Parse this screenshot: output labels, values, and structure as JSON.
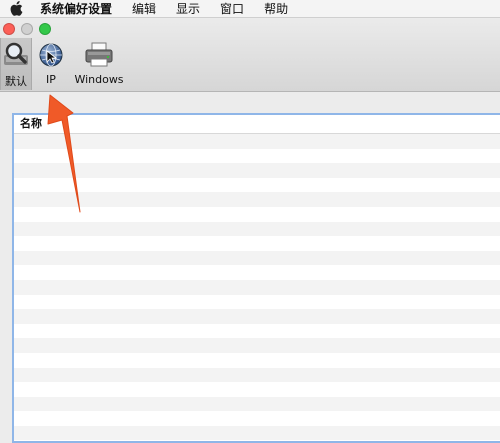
{
  "menubar": {
    "apple_icon": "apple-logo-icon",
    "items": [
      "系统偏好设置",
      "编辑",
      "显示",
      "窗口",
      "帮助"
    ]
  },
  "window": {
    "traffic_lights": {
      "close": "#fc5f57",
      "minimize": "#d0d0d0",
      "zoom": "#34c84a"
    },
    "toolbar": [
      {
        "label": "默认",
        "icon": "magnifier-icon",
        "selected": true
      },
      {
        "label": "IP",
        "icon": "globe-icon",
        "selected": false
      },
      {
        "label": "Windows",
        "icon": "printer-icon",
        "selected": false
      }
    ]
  },
  "list": {
    "column_header": "名称",
    "rows": []
  },
  "annotation": {
    "color": "#f05a28",
    "icon": "arrow-annotation"
  }
}
